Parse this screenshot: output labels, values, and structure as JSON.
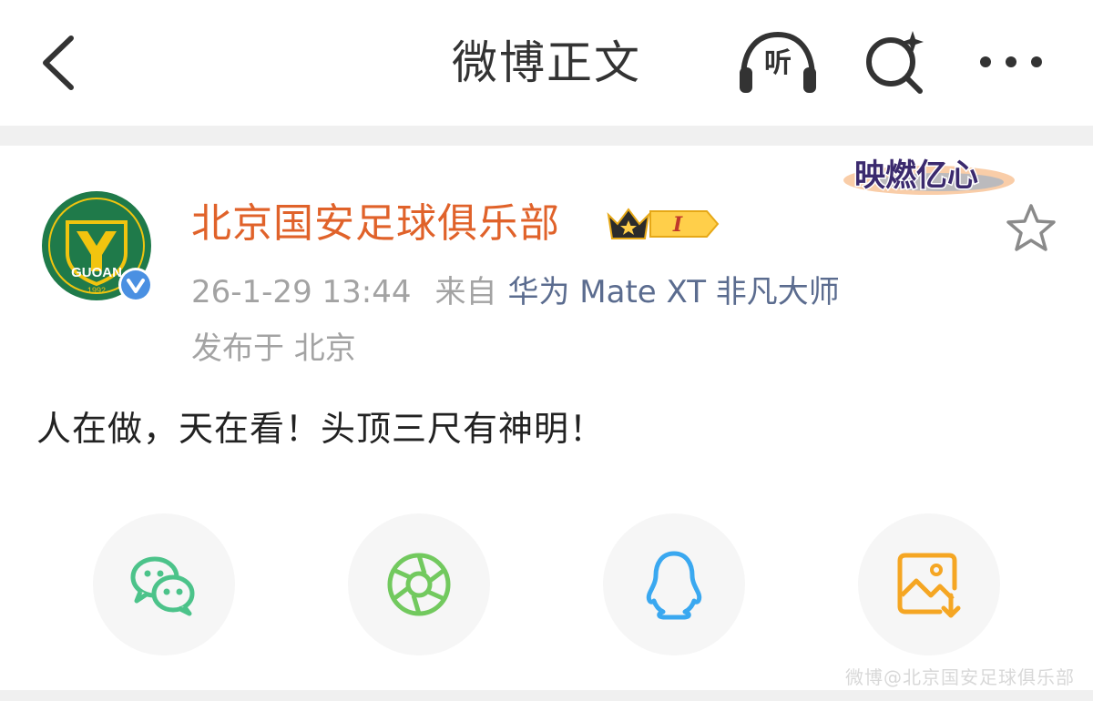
{
  "header": {
    "title": "微博正文",
    "listen_label": "听"
  },
  "post": {
    "author_name": "北京国安足球俱乐部",
    "vip_level": "I",
    "avatar_text": "GUOAN",
    "avatar_year": "1992",
    "verified": true,
    "time": "26-1-29 13:44",
    "from_label": "来自",
    "device": "华为 Mate XT 非凡大师",
    "location": "发布于 北京",
    "content": "人在做，天在看！头顶三尺有神明！",
    "badge_art_text": "映燃亿心"
  },
  "share": {
    "items": [
      "wechat",
      "moments",
      "qq",
      "save-image"
    ]
  },
  "colors": {
    "author": "#e0622a",
    "device_link": "#5b6c8f",
    "meta": "#a3a3a3",
    "wechat": "#4cc38a",
    "moments": "#72c95e",
    "qq": "#3aa8f0",
    "save": "#f5a623"
  },
  "watermark": "微博@北京国安足球俱乐部"
}
